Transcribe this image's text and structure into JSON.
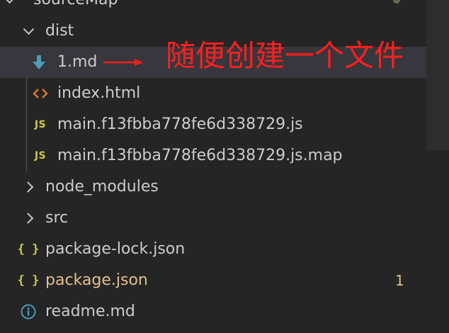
{
  "explorer": {
    "root_folder": {
      "label": "sourceMap"
    },
    "dist_folder": {
      "label": "dist"
    },
    "files_in_dist": [
      {
        "label": "1.md",
        "icon": "download-arrow-icon",
        "selected": true
      },
      {
        "label": "index.html",
        "icon": "html-icon"
      },
      {
        "label": "main.f13fbba778fe6d338729.js",
        "icon": "js-icon",
        "icon_text": "JS"
      },
      {
        "label": "main.f13fbba778fe6d338729.js.map",
        "icon": "js-icon",
        "icon_text": "JS"
      }
    ],
    "top_level": [
      {
        "label": "node_modules",
        "kind": "folder"
      },
      {
        "label": "src",
        "kind": "folder"
      },
      {
        "label": "package-lock.json",
        "kind": "json",
        "icon_text": "{ }"
      },
      {
        "label": "package.json",
        "kind": "json",
        "icon_text": "{ }",
        "modified": true,
        "badge": "1"
      },
      {
        "label": "readme.md",
        "kind": "info"
      }
    ]
  },
  "annotation": {
    "text": "随便创建一个文件",
    "color": "#ff1f1f"
  },
  "colors": {
    "background": "#252526",
    "selected_row": "#37373d",
    "text": "#cccccc",
    "modified_text": "#e2c08d",
    "markdown_icon": "#519aba",
    "js_icon": "#cbcb41",
    "html_icon": "#e37933",
    "info_icon": "#519aba"
  }
}
